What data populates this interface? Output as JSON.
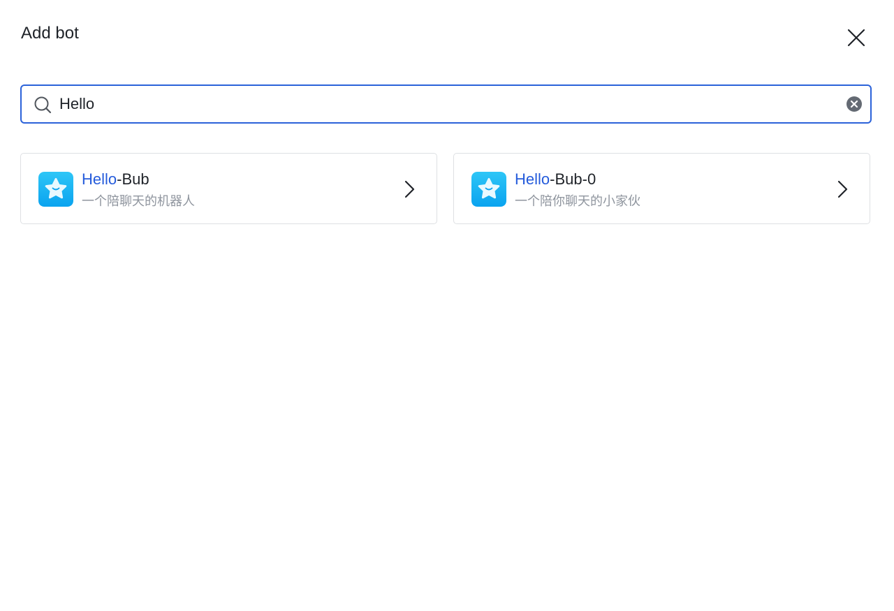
{
  "dialog": {
    "title": "Add bot"
  },
  "search": {
    "value": "Hello",
    "placeholder": ""
  },
  "results": [
    {
      "name_highlight": "Hello",
      "name_rest": "-Bub",
      "description": "一个陪聊天的机器人",
      "icon": "star-avatar-icon"
    },
    {
      "name_highlight": "Hello",
      "name_rest": "-Bub-0",
      "description": "一个陪你聊天的小家伙",
      "icon": "star-avatar-icon"
    }
  ],
  "colors": {
    "accent": "#245bdb",
    "search_border": "#2b62d9",
    "muted_text": "#8f959e",
    "card_border": "#dee0e3",
    "avatar_bg": "#16b8f3"
  }
}
